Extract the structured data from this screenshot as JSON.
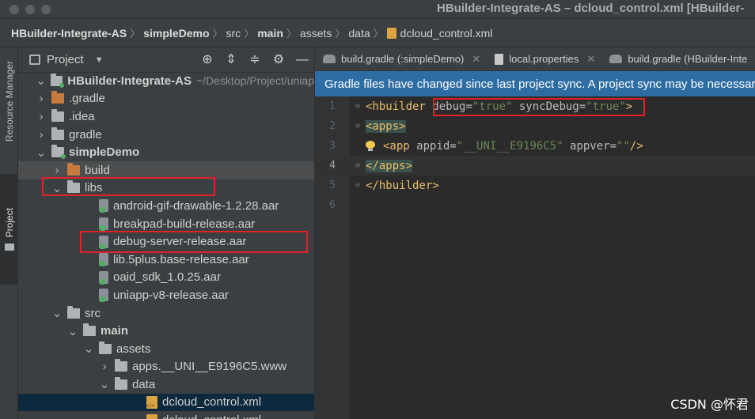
{
  "window": {
    "title": "HBuilder-Integrate-AS – dcloud_control.xml [HBuilder-"
  },
  "breadcrumb": [
    "HBuilder-Integrate-AS",
    "simpleDemo",
    "src",
    "main",
    "assets",
    "data",
    "dcloud_control.xml"
  ],
  "side_tabs": {
    "resource_manager": "Resource Manager",
    "project": "Project"
  },
  "project_panel": {
    "header_label": "Project",
    "tools": [
      "target-icon",
      "expand-all-icon",
      "collapse-all-icon",
      "settings-icon",
      "hide-icon"
    ],
    "tree": [
      {
        "label": "HBuilder-Integrate-AS",
        "hint": "~/Desktop/Project/uniap",
        "arrow": "down",
        "icon": "module",
        "bold": true
      },
      {
        "label": ".gradle",
        "arrow": "right",
        "icon": "folder-orange"
      },
      {
        "label": ".idea",
        "arrow": "right",
        "icon": "folder"
      },
      {
        "label": "gradle",
        "arrow": "right",
        "icon": "folder"
      },
      {
        "label": "simpleDemo",
        "arrow": "down",
        "icon": "module",
        "bold": true
      },
      {
        "label": "build",
        "arrow": "right",
        "icon": "folder-orange"
      },
      {
        "label": "libs",
        "arrow": "down",
        "icon": "folder"
      },
      {
        "label": "android-gif-drawable-1.2.28.aar",
        "icon": "aar"
      },
      {
        "label": "breakpad-build-release.aar",
        "icon": "aar"
      },
      {
        "label": "debug-server-release.aar",
        "icon": "aar"
      },
      {
        "label": "lib.5plus.base-release.aar",
        "icon": "aar"
      },
      {
        "label": "oaid_sdk_1.0.25.aar",
        "icon": "aar"
      },
      {
        "label": "uniapp-v8-release.aar",
        "icon": "aar"
      },
      {
        "label": "src",
        "arrow": "down",
        "icon": "folder"
      },
      {
        "label": "main",
        "arrow": "down",
        "icon": "folder",
        "bold": true
      },
      {
        "label": "assets",
        "arrow": "down",
        "icon": "folder"
      },
      {
        "label": "apps.__UNI__E9196C5.www",
        "arrow": "right",
        "icon": "folder"
      },
      {
        "label": "data",
        "arrow": "down",
        "icon": "folder"
      },
      {
        "label": "dcloud_control.xml",
        "icon": "xml"
      },
      {
        "label": "dcloud_control.xml",
        "icon": "xml"
      }
    ]
  },
  "editor": {
    "tabs": [
      {
        "label": "build.gradle (:simpleDemo)",
        "icon": "gradle-icon"
      },
      {
        "label": "local.properties",
        "icon": "properties-icon"
      },
      {
        "label": "build.gradle (HBuilder-Inte",
        "icon": "gradle-icon"
      }
    ],
    "notice": "Gradle files have changed since last project sync. A project sync may be necessary",
    "lines": [
      {
        "num": "1",
        "open": "<hbuilder ",
        "attr1": "debug=",
        "val1": "\"true\"",
        "attr2": " syncDebug=",
        "val2": "\"true\"",
        "close": ">"
      },
      {
        "num": "2",
        "tag": "<apps>"
      },
      {
        "num": "3",
        "tag": "<app ",
        "attr1": "appid=",
        "val1": "\"__UNI__E9196C5\"",
        "attr2": " appver=",
        "val2": "\"\"",
        "close": "/>"
      },
      {
        "num": "4",
        "tag": "</apps>"
      },
      {
        "num": "5",
        "tag": "</hbuilder>"
      },
      {
        "num": "6"
      }
    ]
  },
  "watermark": "CSDN @怀君",
  "colors": {
    "highlight_box": "#e0222a",
    "notice_bg": "#2e6da4",
    "tag": "#e8bf6a",
    "string": "#6a8759"
  }
}
